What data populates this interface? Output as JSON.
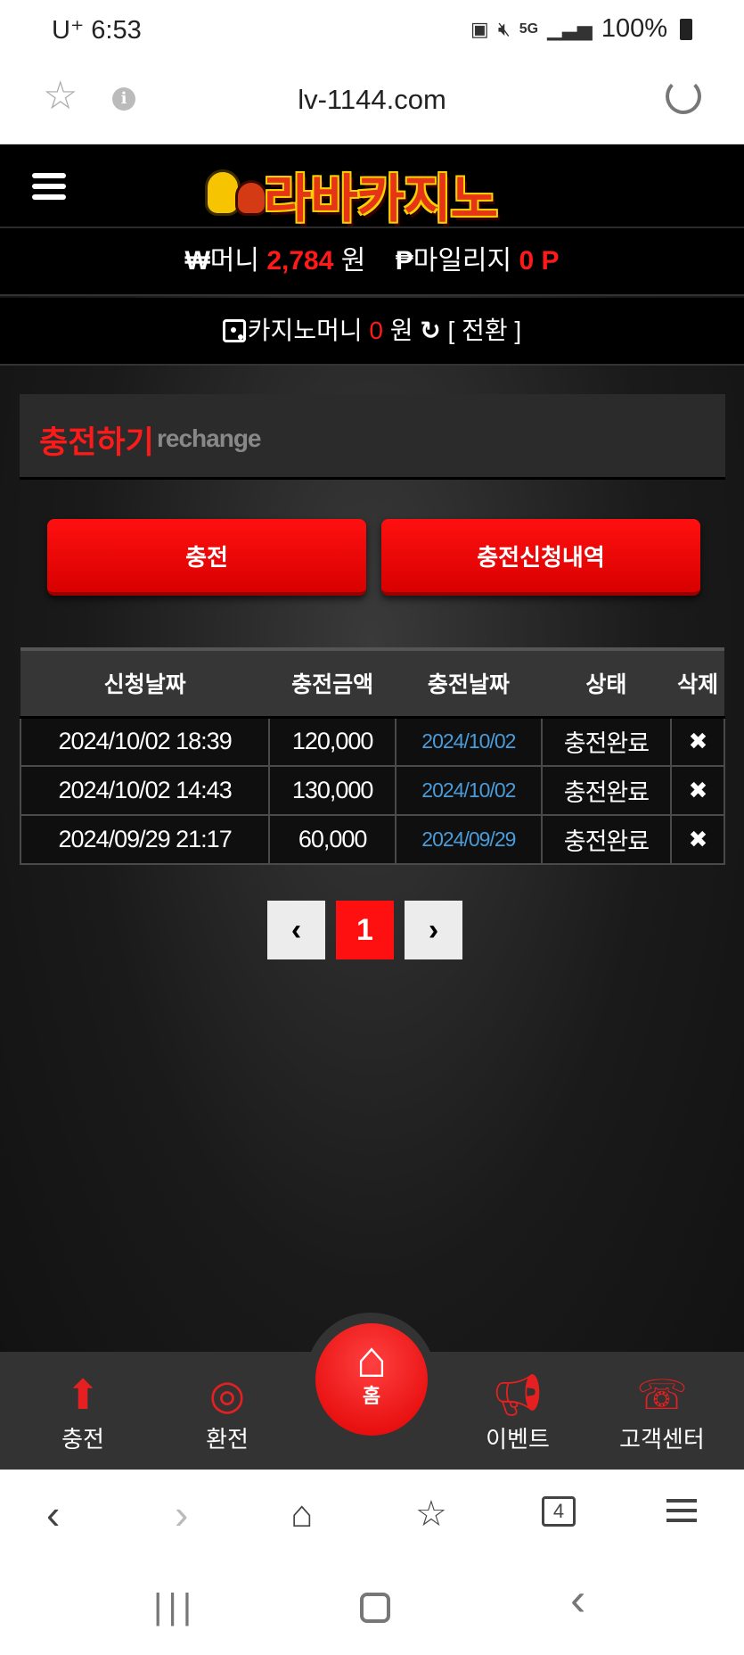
{
  "statusbar": {
    "carrier_time": "U⁺ 6:53",
    "network": "5G",
    "battery": "100%"
  },
  "browser": {
    "url": "lv-1144.com",
    "star_icon": "star-outline-icon",
    "info_icon": "info-icon",
    "reload_icon": "reload-icon",
    "tab_count": "4"
  },
  "site": {
    "logo_text": "라바카지노",
    "money": {
      "money_symbol": "₩",
      "money_label": "머니",
      "money_value": "2,784",
      "money_unit": "원",
      "mileage_symbol": "₱",
      "mileage_label": "마일리지",
      "mileage_value": "0 P"
    },
    "casino": {
      "label": "카지노머니",
      "value": "0",
      "unit": "원",
      "refresh_icon": "↻",
      "convert": "[ 전환 ]"
    },
    "panel": {
      "title": "충전하기",
      "subtitle": "rechange"
    },
    "buttons": {
      "charge": "충전",
      "history": "충전신청내역"
    },
    "table": {
      "headers": [
        "신청날짜",
        "충전금액",
        "충전날짜",
        "상태",
        "삭제"
      ],
      "rows": [
        {
          "requested": "2024/10/02 18:39",
          "amount": "120,000",
          "charged": "2024/10/02",
          "status": "충전완료",
          "delete": "✖"
        },
        {
          "requested": "2024/10/02 14:43",
          "amount": "130,000",
          "charged": "2024/10/02",
          "status": "충전완료",
          "delete": "✖"
        },
        {
          "requested": "2024/09/29 21:17",
          "amount": "60,000",
          "charged": "2024/09/29",
          "status": "충전완료",
          "delete": "✖"
        }
      ]
    },
    "pager": {
      "prev": "‹",
      "current": "1",
      "next": "›"
    },
    "bottom_nav": {
      "charge": "충전",
      "exchange": "환전",
      "home": "홈",
      "event": "이벤트",
      "support": "고객센터"
    }
  },
  "colors": {
    "accent_red": "#ff1010",
    "link_blue": "#4a9bd9",
    "background": "#151515"
  }
}
